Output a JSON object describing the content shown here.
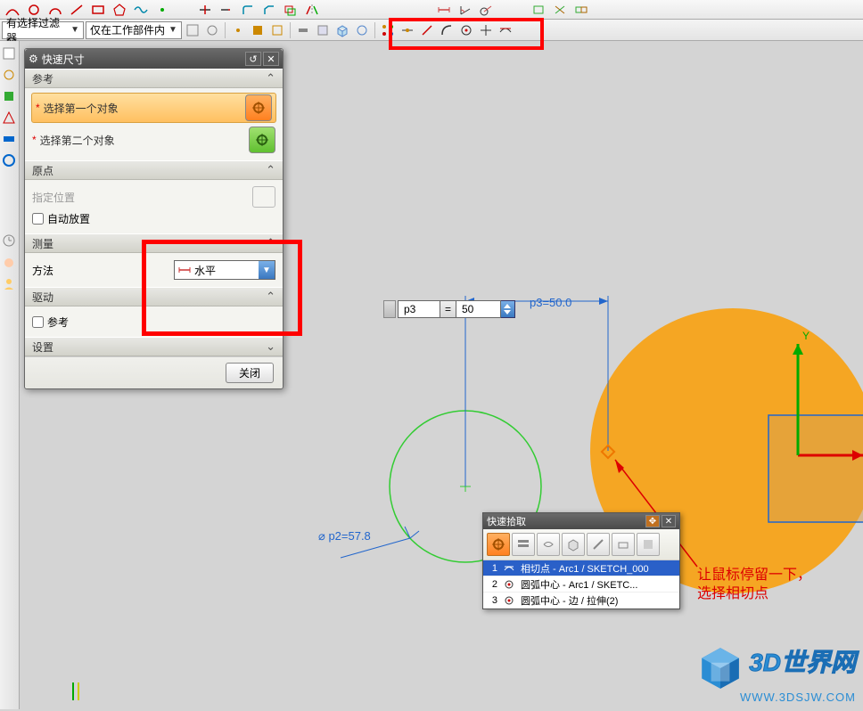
{
  "filter": {
    "combo1": "有选择过滤器",
    "combo2": "仅在工作部件内"
  },
  "dialog": {
    "title": "快速尺寸",
    "sections": {
      "reference": "参考",
      "origin": "原点",
      "measure": "测量",
      "drive": "驱动",
      "settings": "设置"
    },
    "select1": "选择第一个对象",
    "select2": "选择第二个对象",
    "origin_hint": "指定位置",
    "auto_place": "自动放置",
    "method_label": "方法",
    "method_value": "水平",
    "drive_check": "参考",
    "close": "关闭"
  },
  "dim_input": {
    "name": "p3",
    "value": "50"
  },
  "dim_label": "p3=50.0",
  "dia_label": "⌀ p2=57.8",
  "quickpick": {
    "title": "快速拾取",
    "rows": [
      {
        "n": "1",
        "text": "相切点 - Arc1 / SKETCH_000"
      },
      {
        "n": "2",
        "text": "圆弧中心 - Arc1 / SKETC..."
      },
      {
        "n": "3",
        "text": "圆弧中心 - 边 / 拉伸(2)"
      }
    ]
  },
  "annotation": {
    "line1": "让鼠标停留一下，",
    "line2": "选择相切点"
  },
  "watermark": {
    "brand": "3D世界网",
    "url": "WWW.3DSJW.COM"
  }
}
